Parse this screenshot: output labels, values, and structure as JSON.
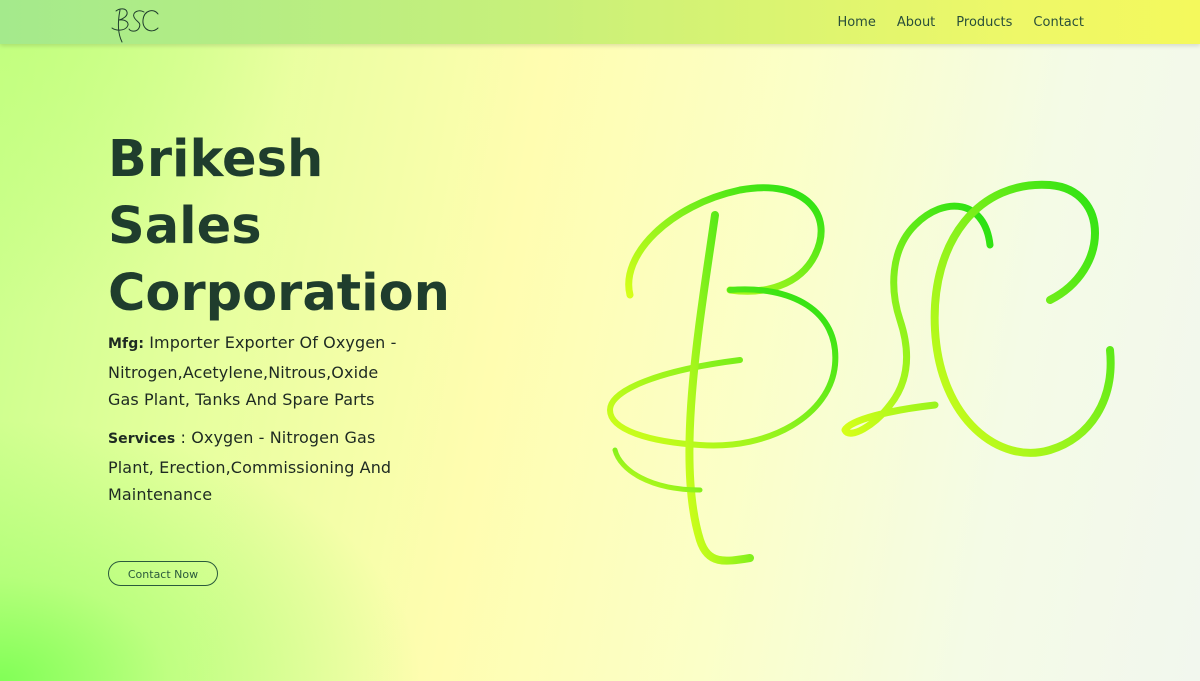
{
  "brand": {
    "logo_text": "BSC",
    "hero_monogram": "BSC"
  },
  "nav": {
    "items": [
      {
        "label": "Home"
      },
      {
        "label": "About"
      },
      {
        "label": "Products"
      },
      {
        "label": "Contact"
      }
    ]
  },
  "hero": {
    "title_lines": [
      "Brikesh",
      "Sales",
      "Corporation"
    ],
    "mfg_label": "Mfg:",
    "mfg_text": " Importer Exporter Of Oxygen - Nitrogen,Acetylene,Nitrous,Oxide Gas Plant, Tanks And Spare Parts",
    "services_label": "Services",
    "services_text": " : Oxygen - Nitrogen Gas Plant, Erection,Commissioning And Maintenance",
    "cta_label": "Contact Now"
  },
  "colors": {
    "heading": "#1f3d2d",
    "monogram_light": "#d6ff1a",
    "monogram_dark": "#22e012"
  }
}
